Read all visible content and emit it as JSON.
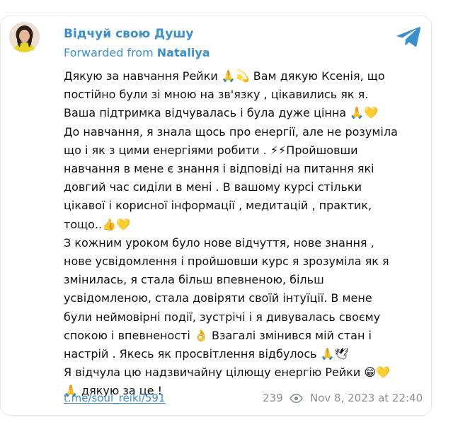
{
  "post": {
    "channel_name": "Відчуй свою Душу",
    "forwarded_prefix": "Forwarded from ",
    "forwarded_from": "Nataliya",
    "message_lines": [
      "Дякую за навчання Рейки 🙏💫 Вам дякую Ксенія, що",
      "постійно були зі мною на зв'язку , цікавились як я.",
      "Ваша підтримка відчувалась і була дуже цінна 🙏💛",
      "До навчання, я знала щось про енергії, але не розуміла",
      "що і як з цими енергіями робити . ⚡⚡Пройшовши",
      "навчання в мене є знання і відповіді на питання які",
      "довгий час сиділи в мені . В вашому курсі стільки",
      "цікавої і корисної інформації , медитацій , практик,",
      "тощо..👍💛",
      "З кожним уроком було нове відчуття, нове знання ,",
      "нове усвідомлення і пройшовши курс я зрозуміла як я",
      "змінилась, я стала більш впевненою, більш",
      "усвідомленою, стала довіряти своїй інтуїції. В мене",
      "були неймовірні події, зустрічі і я дивувалась своєму",
      "спокою і впевненості 👌 Взагалі змінився мій стан і",
      "настрій . Якесь як просвітлення відбулось 🙏🕊",
      "Я відчула цю надзвичайну цілющу енергію Рейки 😁💛",
      "🙏 дякую за це !"
    ],
    "link": "t.me/soul_reiki/591",
    "views": "239",
    "date": "Nov 8, 2023 at 22:40"
  },
  "icons": {
    "telegram": "telegram-logo-icon",
    "views": "eye-icon",
    "avatar": "channel-avatar"
  },
  "colors": {
    "accent": "#3a90cf",
    "text": "#111111",
    "meta": "#8a9096",
    "border": "#e4e7ea"
  }
}
